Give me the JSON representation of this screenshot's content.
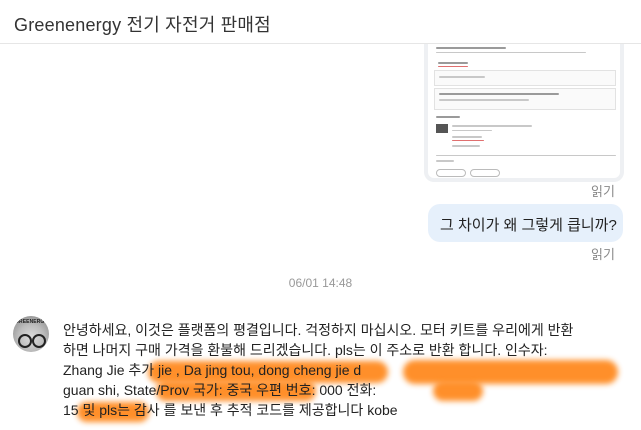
{
  "header": {
    "title": "Greenenergy 전기 자전거 판매점"
  },
  "screenshot_message": {
    "read_label": "읽기"
  },
  "text_message": {
    "text": "그 차이가 왜 그렇게 큽니까?",
    "read_label": "읽기"
  },
  "divider": {
    "timestamp": "06/01 14:48"
  },
  "seller_message": {
    "avatar_label": "GREENERGY",
    "lines": [
      "안녕하세요, 이것은 플랫폼의 평결입니다. 걱정하지 마십시오. 모터 키트를 우리에게 반환",
      "하면 나머지 구매 가격을 환불해 드리겠습니다. pls는 이 주소로 반환 합니다. 인수자:",
      "Zhang Jie 추가 jie , Da jing tou, dong cheng jie d",
      "guan shi, State/Prov 국가: 중국 우편 번호: 000 전화:",
      "15 및 pls는 감사 를 보낸 후 추적 코드를 제공합니다 kobe"
    ],
    "highlight_color": "#ff8a1f"
  }
}
